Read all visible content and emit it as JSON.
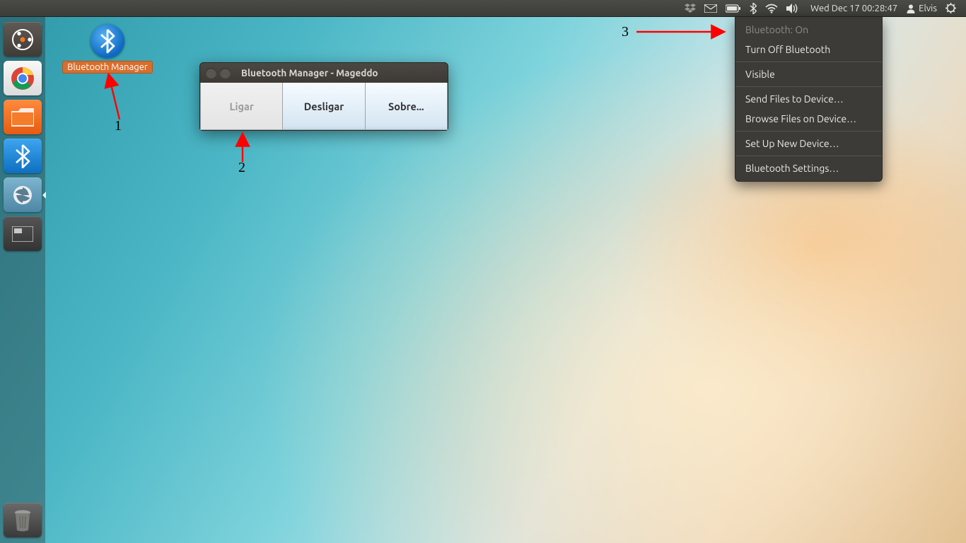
{
  "top_panel": {
    "datetime": "Wed Dec 17 00:28:47",
    "user": "Elvis"
  },
  "desktop_icon": {
    "label": "Bluetooth Manager"
  },
  "app_window": {
    "title": "Bluetooth Manager - Mageddo",
    "buttons": {
      "on": "Ligar",
      "off": "Desligar",
      "about": "Sobre..."
    }
  },
  "bt_menu": {
    "status": "Bluetooth: On",
    "turn_off": "Turn Off Bluetooth",
    "visible": "Visible",
    "send_files": "Send Files to Device…",
    "browse_files": "Browse Files on Device…",
    "setup": "Set Up New Device…",
    "settings": "Bluetooth Settings…"
  },
  "annotations": {
    "n1": "1",
    "n2": "2",
    "n3": "3"
  }
}
